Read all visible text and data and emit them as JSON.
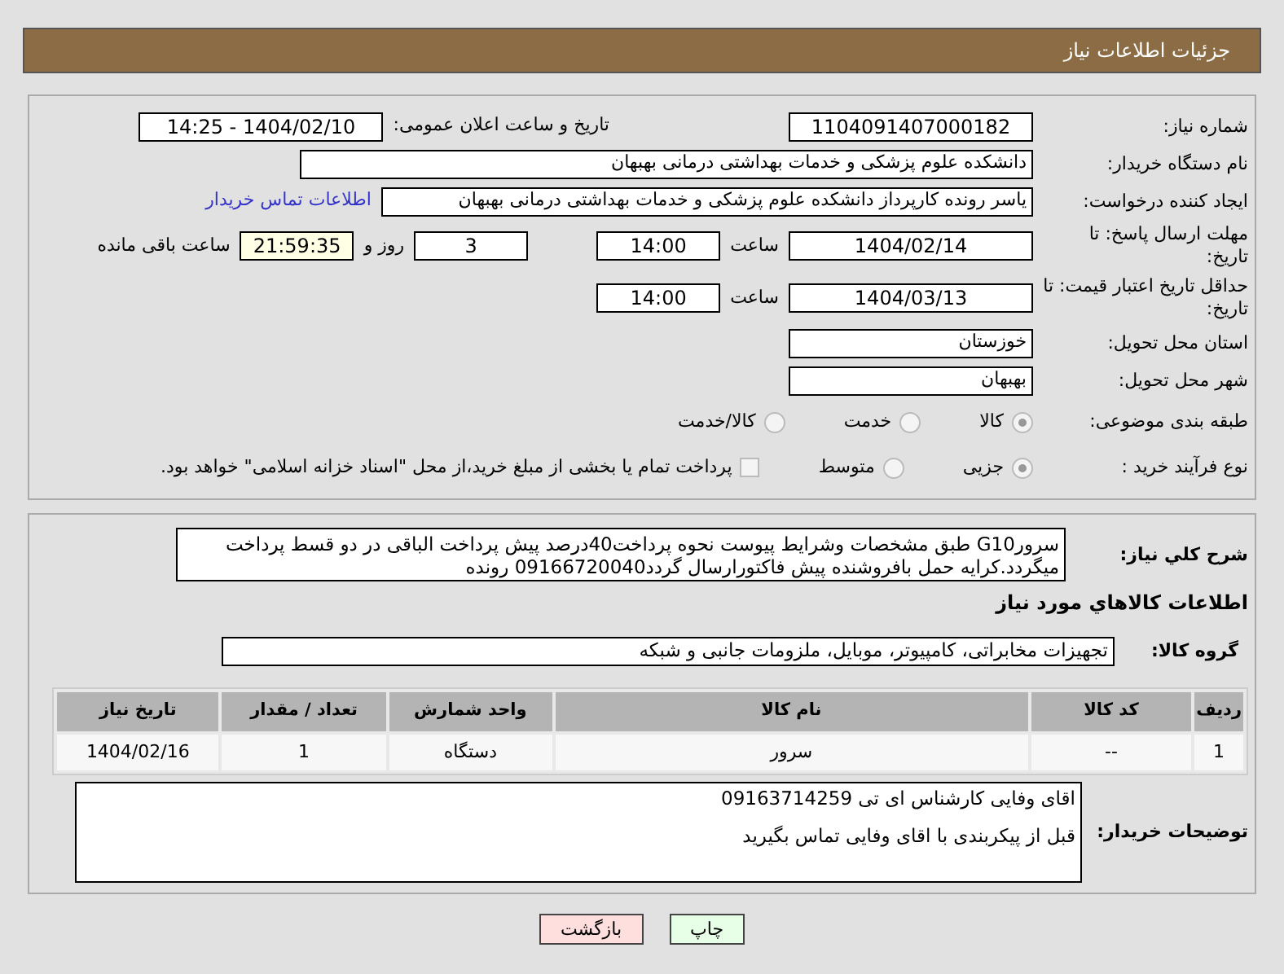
{
  "header": {
    "title": "جزئیات اطلاعات نیاز"
  },
  "need_number": {
    "label": "شماره نیاز:",
    "value": "1104091407000182"
  },
  "announce": {
    "label": "تاریخ و ساعت اعلان عمومی:",
    "value": "1404/02/10 - 14:25"
  },
  "buyer": {
    "label": "نام دستگاه خریدار:",
    "value": "دانشکده علوم پزشکی و خدمات بهداشتی  درمانی بهبهان"
  },
  "creator": {
    "label": "ایجاد کننده درخواست:",
    "value": "یاسر رونده کارپرداز دانشکده علوم پزشکی و خدمات بهداشتی  درمانی بهبهان",
    "link": "اطلاعات تماس خریدار"
  },
  "deadline": {
    "label": "مهلت ارسال پاسخ: تا تاریخ:",
    "date": "1404/02/14",
    "time_label": "ساعت",
    "time": "14:00",
    "days": "3",
    "days_label": "روز و",
    "remaining": "21:59:35",
    "remaining_label": "ساعت باقی مانده"
  },
  "validity": {
    "label": "حداقل تاریخ اعتبار قیمت: تا تاریخ:",
    "date": "1404/03/13",
    "time_label": "ساعت",
    "time": "14:00"
  },
  "province": {
    "label": "استان محل تحویل:",
    "value": "خوزستان"
  },
  "city": {
    "label": "شهر محل تحویل:",
    "value": "بهبهان"
  },
  "category": {
    "label": "طبقه بندی موضوعی:",
    "options": [
      {
        "label": "کالا",
        "selected": true
      },
      {
        "label": "خدمت",
        "selected": false
      },
      {
        "label": "کالا/خدمت",
        "selected": false
      }
    ]
  },
  "process": {
    "label": "نوع فرآیند خرید :",
    "options": [
      {
        "label": "جزیی",
        "selected": true
      },
      {
        "label": "متوسط",
        "selected": false
      }
    ],
    "treasury": {
      "label": "پرداخت تمام یا بخشی از مبلغ خرید،از محل \"اسناد خزانه اسلامی\" خواهد بود.",
      "checked": false
    }
  },
  "description": {
    "label": "شرح کلي نياز:",
    "value": "سرورG10 طبق مشخصات وشرایط پیوست نحوه پرداخت40درصد پیش پرداخت الباقی در دو قسط پرداخت میگردد.کرایه حمل بافروشنده پیش فاکتورارسال گردد09166720040 رونده"
  },
  "goods_title": "اطلاعات کالاهاي مورد نياز",
  "goods_group": {
    "label": "گروه کالا:",
    "value": "تجهیزات مخابراتی، کامپیوتر، موبایل، ملزومات جانبی و شبکه"
  },
  "table": {
    "columns": [
      "ردیف",
      "کد کالا",
      "نام کالا",
      "واحد شمارش",
      "تعداد / مقدار",
      "تاریخ نیاز"
    ],
    "rows": [
      [
        "1",
        "--",
        "سرور",
        "دستگاه",
        "1",
        "1404/02/16"
      ]
    ]
  },
  "notes": {
    "label": "توضیحات خریدار:",
    "lines": [
      "اقای وفایی کارشناس ای تی 09163714259",
      "قبل از پیکربندی با اقای وفایی تماس بگیرید"
    ]
  },
  "buttons": [
    {
      "kind": "print",
      "label": "چاپ"
    },
    {
      "kind": "back",
      "label": "بازگشت"
    }
  ]
}
